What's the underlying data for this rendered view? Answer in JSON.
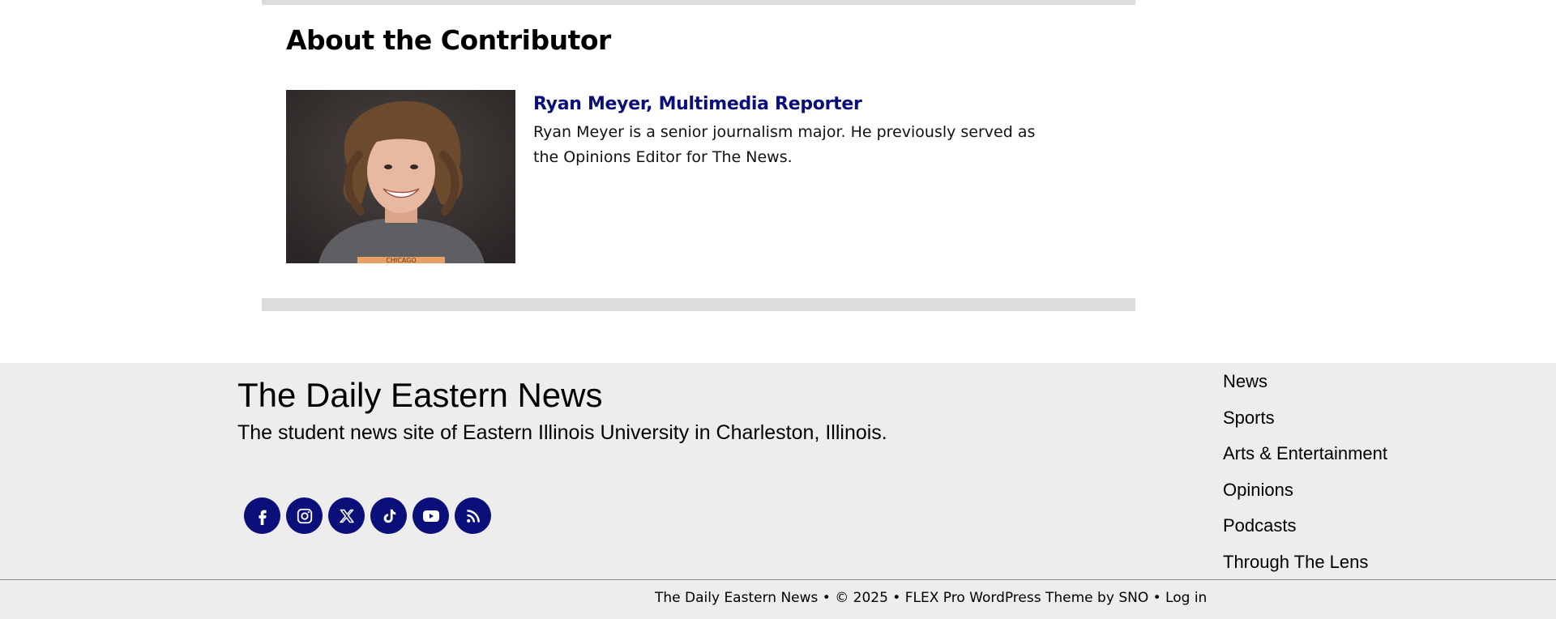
{
  "contributor_section": {
    "title": "About the Contributor",
    "name": "Ryan Meyer, Multimedia Reporter",
    "bio": "Ryan Meyer is a senior journalism major. He previously served as the Opinions Editor for The News.",
    "photo_shirt_text": "CHICAGO",
    "name_color": "#0b0f7a"
  },
  "footer": {
    "site_name": "The Daily Eastern News",
    "tagline": "The student news site of Eastern Illinois University in Charleston, Illinois.",
    "social_icons": [
      "facebook-icon",
      "instagram-icon",
      "x-icon",
      "tiktok-icon",
      "youtube-icon",
      "rss-icon"
    ],
    "social_color": "#0b0f7a",
    "nav": [
      "News",
      "Sports",
      "Arts & Entertainment",
      "Opinions",
      "Podcasts",
      "Through The Lens"
    ],
    "copyright": {
      "site": "The Daily Eastern News",
      "sep1": " • ",
      "year": "© 2025",
      "sep2": " • ",
      "theme": "FLEX Pro WordPress Theme",
      "by": " by ",
      "vendor": "SNO",
      "sep3": " • ",
      "login": "Log in"
    },
    "background": "#ededed"
  }
}
